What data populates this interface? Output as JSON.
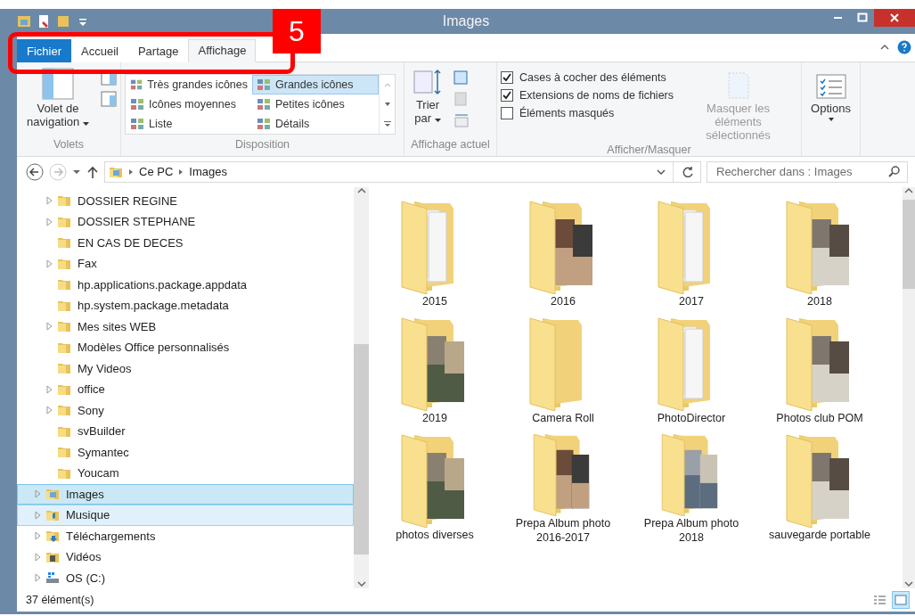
{
  "window": {
    "title": "Images"
  },
  "annotation": {
    "label": "5"
  },
  "tabs": [
    {
      "label": "Fichier",
      "kind": "file",
      "selected": false
    },
    {
      "label": "Accueil",
      "kind": "tab",
      "selected": false
    },
    {
      "label": "Partage",
      "kind": "tab",
      "selected": false
    },
    {
      "label": "Affichage",
      "kind": "tab",
      "selected": true
    }
  ],
  "ribbon": {
    "panes": {
      "button": "Volet de navigation",
      "group": "Volets"
    },
    "layout": {
      "group": "Disposition",
      "options": [
        {
          "label": "Très grandes icônes",
          "selected": false
        },
        {
          "label": "Grandes icônes",
          "selected": true
        },
        {
          "label": "Icônes moyennes",
          "selected": false
        },
        {
          "label": "Petites icônes",
          "selected": false
        },
        {
          "label": "Liste",
          "selected": false
        },
        {
          "label": "Détails",
          "selected": false
        }
      ]
    },
    "current_view": {
      "group": "Affichage actuel",
      "sort_button": "Trier par"
    },
    "show_hide": {
      "group": "Afficher/Masquer",
      "checkboxes": [
        {
          "label": "Cases à cocher des éléments",
          "checked": true
        },
        {
          "label": "Extensions de noms de fichiers",
          "checked": true
        },
        {
          "label": "Éléments masqués",
          "checked": false
        }
      ],
      "hide_selected": {
        "label": "Masquer les éléments sélectionnés",
        "disabled": true
      }
    },
    "options": {
      "label": "Options"
    }
  },
  "address_bar": {
    "path": [
      "Ce PC",
      "Images"
    ]
  },
  "search": {
    "placeholder": "Rechercher dans : Images"
  },
  "tree": {
    "nested_items": [
      {
        "label": "DOSSIER REGINE",
        "expandable": true
      },
      {
        "label": "DOSSIER STEPHANE",
        "expandable": true
      },
      {
        "label": "EN CAS DE DECES",
        "expandable": false
      },
      {
        "label": "Fax",
        "expandable": true
      },
      {
        "label": "hp.applications.package.appdata",
        "expandable": false
      },
      {
        "label": "hp.system.package.metadata",
        "expandable": false
      },
      {
        "label": "Mes sites WEB",
        "expandable": true
      },
      {
        "label": "Modèles Office personnalisés",
        "expandable": false
      },
      {
        "label": "My Videos",
        "expandable": false
      },
      {
        "label": "office",
        "expandable": true
      },
      {
        "label": "Sony",
        "expandable": true
      },
      {
        "label": "svBuilder",
        "expandable": false
      },
      {
        "label": "Symantec",
        "expandable": false
      },
      {
        "label": "Youcam",
        "expandable": false
      }
    ],
    "items": [
      {
        "label": "Images",
        "kind": "pictures",
        "selected": true,
        "hovered": false
      },
      {
        "label": "Musique",
        "kind": "music",
        "selected": false,
        "hovered": true
      },
      {
        "label": "Téléchargements",
        "kind": "downloads",
        "selected": false,
        "hovered": false
      },
      {
        "label": "Vidéos",
        "kind": "videos",
        "selected": false,
        "hovered": false
      },
      {
        "label": "OS (C:)",
        "kind": "drive",
        "selected": false,
        "hovered": false
      }
    ]
  },
  "folders": [
    {
      "name": "2015",
      "kind": "documents"
    },
    {
      "name": "2016",
      "kind": "photos"
    },
    {
      "name": "2017",
      "kind": "documents"
    },
    {
      "name": "2018",
      "kind": "photos"
    },
    {
      "name": "2019",
      "kind": "photos"
    },
    {
      "name": "Camera Roll",
      "kind": "empty"
    },
    {
      "name": "PhotoDirector",
      "kind": "documents"
    },
    {
      "name": "Photos club POM",
      "kind": "photos"
    },
    {
      "name": "photos diverses",
      "kind": "photos"
    },
    {
      "name": "Prepa Album photo 2016-2017",
      "kind": "photos"
    },
    {
      "name": "Prepa Album photo 2018",
      "kind": "photos"
    },
    {
      "name": "sauvegarde portable",
      "kind": "photos"
    }
  ],
  "status_bar": {
    "count": "37 élément(s)"
  }
}
